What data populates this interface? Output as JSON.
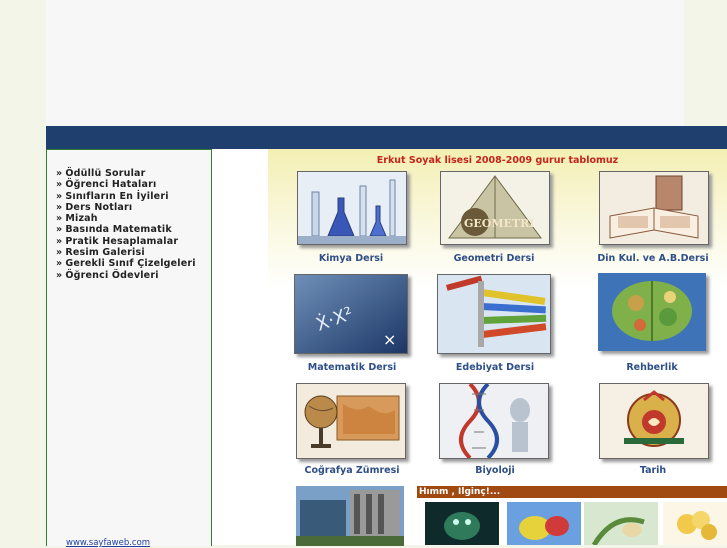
{
  "sidebar": {
    "items": [
      {
        "label": "Ödüllü Sorular"
      },
      {
        "label": "Öğrenci Hataları"
      },
      {
        "label": "Sınıfların En İyileri"
      },
      {
        "label": "Ders Notları"
      },
      {
        "label": "Mizah"
      },
      {
        "label": "Basında Matematik"
      },
      {
        "label": "Pratik Hesaplamalar"
      },
      {
        "label": "Resim Galerisi"
      },
      {
        "label": "Gerekli Sınıf Çizelgeleri"
      },
      {
        "label": "Öğrenci Ödevleri"
      }
    ],
    "arrow": "»",
    "footer_link": "www.sayfaweb.com"
  },
  "main": {
    "headline": "Erkut Soyak lisesi 2008-2009 gurur tablomuz",
    "tiles": [
      {
        "label": "Kimya Dersi",
        "icon": "chemistry-flasks-icon"
      },
      {
        "label": "Geometri Dersi",
        "icon": "geometry-pyramid-icon",
        "image_text": "GEOMETRI"
      },
      {
        "label": "Din Kul. ve A.B.Dersi",
        "icon": "book-icon"
      },
      {
        "label": "Matematik Dersi",
        "icon": "math-formula-icon"
      },
      {
        "label": "Edebiyat Dersi",
        "icon": "pencils-icon"
      },
      {
        "label": "Rehberlik",
        "icon": "brain-icon"
      },
      {
        "label": "Coğrafya Zümresi",
        "icon": "globe-icon"
      },
      {
        "label": "Biyoloji",
        "icon": "dna-icon"
      },
      {
        "label": "Tarih",
        "icon": "ottoman-seal-icon"
      }
    ],
    "himm_title": "Hımm , Ilginç!..."
  }
}
